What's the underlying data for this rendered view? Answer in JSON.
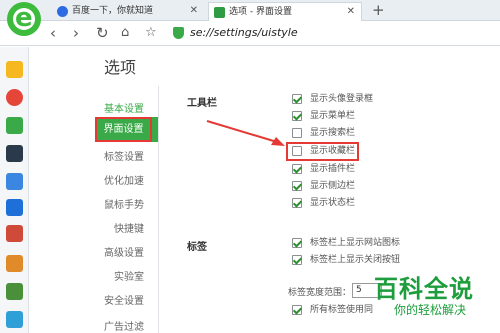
{
  "browser": {
    "tabs": [
      {
        "label": "百度一下，你就知道",
        "active": false
      },
      {
        "label": "选项 - 界面设置",
        "active": true
      }
    ],
    "new_tab": "+",
    "url": "se://settings/uistyle"
  },
  "page": {
    "title": "选项",
    "nav": [
      "基本设置",
      "界面设置",
      "标签设置",
      "优化加速",
      "鼠标手势",
      "快捷键",
      "高级设置",
      "实验室",
      "安全设置",
      "广告过滤"
    ],
    "active_nav": "界面设置"
  },
  "toolbar_section": {
    "title": "工具栏",
    "options": [
      {
        "label": "显示头像登录框",
        "checked": true
      },
      {
        "label": "显示菜单栏",
        "checked": true
      },
      {
        "label": "显示搜索栏",
        "checked": false
      },
      {
        "label": "显示收藏栏",
        "checked": false
      },
      {
        "label": "显示插件栏",
        "checked": true
      },
      {
        "label": "显示侧边栏",
        "checked": true
      },
      {
        "label": "显示状态栏",
        "checked": true
      }
    ]
  },
  "tabs_section": {
    "title": "标签",
    "options": [
      {
        "label": "标签栏上显示网站图标",
        "checked": true
      },
      {
        "label": "标签栏上显示关闭按钮",
        "checked": true
      }
    ],
    "width_label": "标签宽度范围：",
    "width_value": "5",
    "last_option": "所有标签使用同"
  },
  "watermark": {
    "title": "百科全说",
    "subtitle": "你的轻松解决"
  },
  "colors": {
    "accent": "#3aa948",
    "highlight": "#e53935"
  }
}
